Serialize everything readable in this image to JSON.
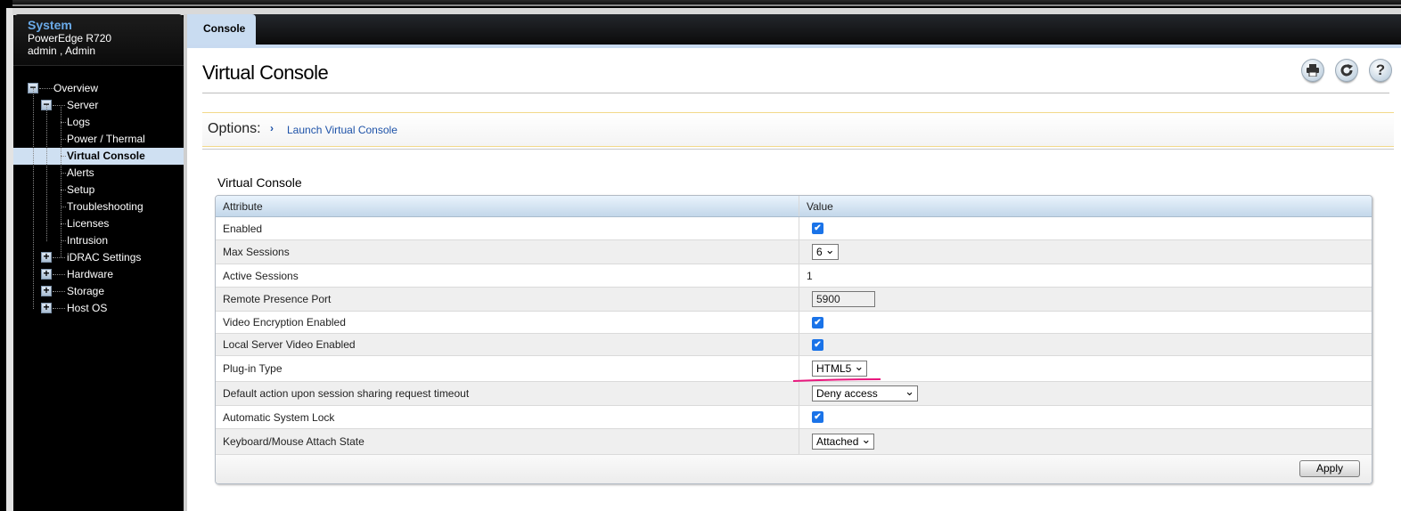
{
  "sidebar": {
    "system_title": "System",
    "model": "PowerEdge R720",
    "user": "admin , Admin",
    "tree": [
      {
        "label": "Overview",
        "level": 0,
        "toggle": "minus"
      },
      {
        "label": "Server",
        "level": 1,
        "toggle": "minus"
      },
      {
        "label": "Logs",
        "level": 2
      },
      {
        "label": "Power / Thermal",
        "level": 2
      },
      {
        "label": "Virtual Console",
        "level": 2,
        "selected": true
      },
      {
        "label": "Alerts",
        "level": 2
      },
      {
        "label": "Setup",
        "level": 2
      },
      {
        "label": "Troubleshooting",
        "level": 2
      },
      {
        "label": "Licenses",
        "level": 2
      },
      {
        "label": "Intrusion",
        "level": 2
      },
      {
        "label": "iDRAC Settings",
        "level": 1,
        "toggle": "plus"
      },
      {
        "label": "Hardware",
        "level": 1,
        "toggle": "plus"
      },
      {
        "label": "Storage",
        "level": 1,
        "toggle": "plus"
      },
      {
        "label": "Host OS",
        "level": 1,
        "toggle": "plus"
      }
    ]
  },
  "tabs": [
    {
      "label": "Console",
      "active": true
    }
  ],
  "page": {
    "title": "Virtual Console",
    "header_icons": [
      "print-icon",
      "refresh-icon",
      "help-icon"
    ],
    "options_label": "Options:",
    "options_link": "Launch Virtual Console"
  },
  "section": {
    "title": "Virtual Console",
    "columns": [
      "Attribute",
      "Value"
    ],
    "rows": [
      {
        "attribute": "Enabled",
        "type": "checkbox",
        "value": true
      },
      {
        "attribute": "Max Sessions",
        "type": "select",
        "value": "6"
      },
      {
        "attribute": "Active Sessions",
        "type": "text",
        "value": "1"
      },
      {
        "attribute": "Remote Presence Port",
        "type": "input",
        "value": "5900"
      },
      {
        "attribute": "Video Encryption Enabled",
        "type": "checkbox",
        "value": true
      },
      {
        "attribute": "Local Server Video Enabled",
        "type": "checkbox",
        "value": true
      },
      {
        "attribute": "Plug-in Type",
        "type": "select",
        "value": "HTML5"
      },
      {
        "attribute": "Default action upon session sharing request timeout",
        "type": "select",
        "value": "Deny access"
      },
      {
        "attribute": "Automatic System Lock",
        "type": "checkbox",
        "value": true
      },
      {
        "attribute": "Keyboard/Mouse Attach State",
        "type": "select",
        "value": "Attached"
      }
    ],
    "apply_label": "Apply"
  },
  "colors": {
    "accent_link": "#1d52a8",
    "selected_bg": "#cfe0f2",
    "checkbox": "#1a73e8",
    "annotation": "#e8177d"
  }
}
